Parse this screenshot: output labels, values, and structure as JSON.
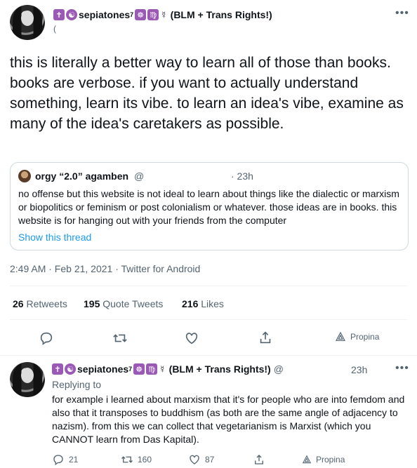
{
  "tweet": {
    "display_name": "sepiatones",
    "name_sup": "7",
    "name_suffix": "(BLM + Trans Rights!)",
    "handle": "(",
    "text": "this is literally a better way to learn all of those than books. books are verbose. if you want to actually understand something, learn its vibe. to learn an idea's vibe, examine as many of the idea's caretakers as possible.",
    "timestamp": "2:49 AM · Feb 21, 2021 · Twitter for Android",
    "stats": {
      "retweets_count": "26",
      "retweets_label": "Retweets",
      "quote_count": "195",
      "quote_label": "Quote Tweets",
      "likes_count": "216",
      "likes_label": "Likes"
    },
    "promote_label": "Propina"
  },
  "quote": {
    "name": "orgy “2.0” agamben",
    "handle": "@",
    "age": "· 23h",
    "text": "no offense but this website is not ideal to learn about things like the dialectic or marxism or biopolitics or feminism or post colonialism or whatever. those ideas are in books. this website is for hanging out with your friends from the computer",
    "show_thread": "Show this thread"
  },
  "reply": {
    "display_name": "sepiatones",
    "name_sup": "7",
    "name_suffix": "(BLM + Trans Rights!)",
    "handle": "@",
    "age": "23h",
    "replying_to": "Replying to",
    "text": "for example i learned about marxism that it's for people who are into femdom and also that it transposes to buddhism (as both are the same angle of adjacency to nazism). from this we can collect that vegetarianism is Marxist (which you CANNOT learn from Das Kapital).",
    "replies": "21",
    "retweets": "160",
    "likes": "87",
    "promote_label": "Propina"
  },
  "icons": {
    "more": "more-icon",
    "reply": "reply-icon",
    "retweet": "retweet-icon",
    "like": "like-icon",
    "share": "share-icon",
    "promote": "promote-icon"
  },
  "colors": {
    "accent": "#1d9bf0",
    "emoji_purple": "#9b59b6",
    "muted": "#536471"
  }
}
